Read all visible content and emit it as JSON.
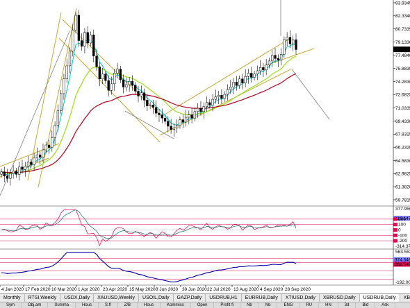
{
  "chart": {
    "symbol": "USDRUB",
    "price_ticks": [
      "83.9345",
      "82.3340",
      "80.7335",
      "79.1330",
      "77.4840",
      "75.8835",
      "74.2830",
      "72.6825",
      "71.0335",
      "69.4330",
      "67.8325",
      "66.2320",
      "64.5830",
      "62.9825",
      "61.3820",
      "59.7815"
    ],
    "current_price": "78.2233",
    "date_ticks": [
      "4 Jan 2020",
      "17 Feb 2020",
      "10 Mar 2020",
      "1 Apr 2020",
      "23 Apr 2020",
      "15 May 2020",
      "8 Jun 2020",
      "30 Jun 2020",
      "22 Jul 2020",
      "13 Aug 2020",
      "4 Sep 2020",
      "28 Sep 2020"
    ],
    "colors": {
      "bull": "#000000",
      "bear": "#000000",
      "ema_fast": "#00c8c8",
      "ema_mid": "#99e01a",
      "ema_slow": "#b4001e",
      "trendline": "#c8a832",
      "projection": "#808080",
      "osc": "#e0004f",
      "osc_line": "#0b6e6e",
      "macd": "#0000aa"
    }
  },
  "oscillator": {
    "top_label": "377.9566",
    "value_label": "216.1477",
    "bottom_label": "-314.3755",
    "level_labels": [
      "200",
      "100",
      "0",
      "-100",
      "-200"
    ]
  },
  "macd_pane": {
    "top_label": "563.5536",
    "value_label": "374.3491",
    "value_label2": "262.5491",
    "bottom_label": "-192.0099"
  },
  "tabs": [
    "Monthly",
    "RTSI,Weekly",
    "USDX,Daily",
    "XAUUSD,Weekly",
    "USOIL,Daily",
    "GAZP,Daily",
    "USDRUB,H1",
    "EURRUB,Daily",
    "XTIUSD,Daily",
    "XBRUSD,Daily",
    "USDRUB,Daily",
    "XBRUSD,Daily"
  ],
  "active_tab_index": 10,
  "scroll": {
    "left": "◄",
    "right": "►"
  },
  "bottom_strip": [
    "Sym",
    "Obj.am",
    "Summa",
    "Hous",
    "S.fl",
    "Z/B",
    "Hous",
    "Kommiss",
    "Open",
    "Profit fi",
    "Nb",
    "Nb",
    "ENG",
    "RU",
    "HN",
    "3d",
    "Bid",
    "Ask"
  ],
  "series": {
    "closes": [
      63.2,
      62.7,
      62.4,
      63.0,
      63.3,
      62.9,
      63.8,
      63.5,
      63.9,
      64.4,
      64.1,
      64.9,
      65.3,
      65.0,
      65.9,
      66.5,
      66.2,
      67.4,
      68.9,
      70.7,
      72.8,
      74.6,
      76.2,
      78.0,
      80.6,
      82.4,
      79.3,
      78.6,
      80.3,
      79.0,
      80.0,
      77.4,
      76.1,
      74.6,
      75.2,
      74.4,
      73.2,
      74.0,
      75.3,
      75.8,
      74.5,
      73.6,
      73.9,
      74.3,
      73.8,
      73.1,
      72.5,
      72.9,
      72.0,
      71.3,
      71.4,
      71.1,
      70.4,
      70.2,
      69.8,
      69.4,
      68.8,
      68.4,
      68.6,
      68.9,
      69.6,
      69.3,
      69.9,
      70.2,
      69.8,
      70.6,
      71.0,
      70.6,
      71.2,
      71.7,
      71.4,
      72.1,
      72.4,
      72.6,
      72.2,
      72.7,
      73.3,
      73.6,
      74.2,
      73.8,
      74.6,
      74.1,
      74.9,
      75.3,
      74.8,
      75.2,
      75.6,
      76.0,
      75.7,
      76.3,
      76.8,
      77.5,
      77.1,
      76.9,
      77.6,
      79.4,
      79.7,
      78.9,
      79.4,
      78.2
    ]
  }
}
